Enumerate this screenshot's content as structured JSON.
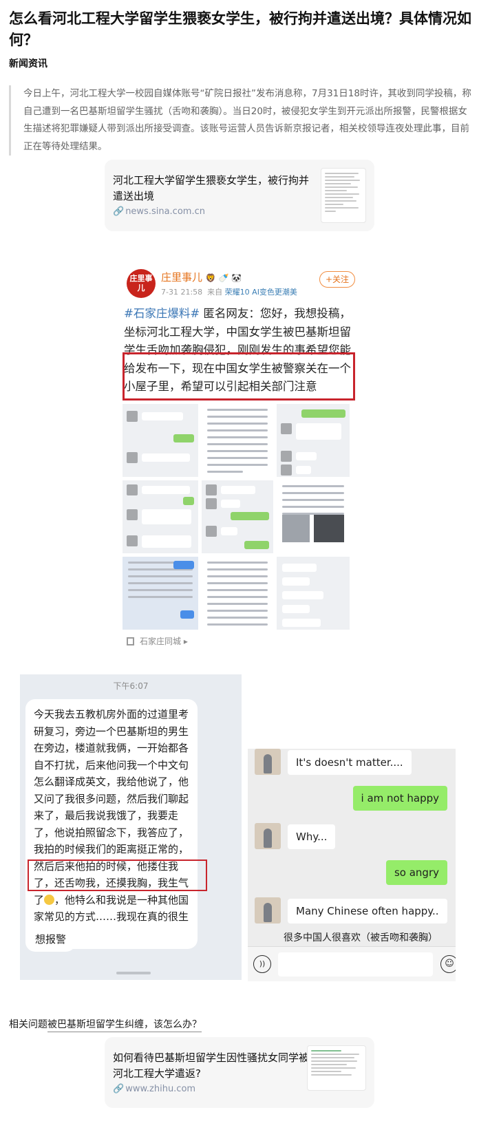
{
  "article": {
    "title": "怎么看河北工程大学留学生猥亵女学生，被行拘并遣送出境？具体情况如何？",
    "author": "新闻资讯",
    "quote": "今日上午，河北工程大学一校园自媒体账号“矿院日报社”发布消息称，7月31日18时许，其收到同学投稿，称自己遭到一名巴基斯坦留学生骚扰（舌吻和袭胸）。当日20时，被侵犯女学生到开元派出所报警，民警根据女生描述将犯罪嫌疑人带到派出所接受调查。该账号运营人员告诉新京报记者，相关校领导连夜处理此事，目前正在等待处理结果。"
  },
  "link_card_1": {
    "title": "河北工程大学留学生猥亵女学生，被行拘并遣送出境",
    "url": "news.sina.com.cn",
    "icon": "link-chain-icon"
  },
  "weibo": {
    "avatar_text": "庄里事儿",
    "name": "庄里事儿",
    "badges": "🦁 🍼 🐼",
    "time": "7-31 21:58",
    "source_prefix": "来自",
    "device": "荣耀10 AI变色更潮美",
    "follow_label": "+关注",
    "hashtag": "#石家庄爆料#",
    "text_1": "匿名网友：您好，我想投稿，坐标河北工程大学，中国女学生被巴基斯坦留学生舌吻加袭胸侵犯，刚刚发生的事",
    "text_2": "希望您能给发布一下，现在中国女学生被警察关在一个小屋子里，希望可以引起相关部门注意",
    "location": "石家庄同城",
    "location_icon": "location-grid-icon"
  },
  "chat_left": {
    "time": "下午6:07",
    "message_1": "今天我去五教机房外面的过道里考研复习，旁边一个巴基斯坦的男生在旁边，楼道就我俩，一开始都各自不打扰，后来他问我一个中文句怎么翻译成英文，我给他说了，他又问了我很多问题，然后我们聊起来了，最后我说我饿了，我要走了，他说拍照留念下，我答应了，我拍的时候我们的距离挺正常的，然后后来他拍的时候，他搂住我了，还舌吻我，还摸我胸，我生气了",
    "message_1_tail": "，他特么和我说是一种其他国家常见的方式……我现在真的很生气",
    "message_2": "想报警"
  },
  "chat_right": {
    "messages": [
      {
        "side": "in",
        "text": "It's doesn't matter...."
      },
      {
        "side": "out",
        "text": "i am not happy"
      },
      {
        "side": "in",
        "text": "Why..."
      },
      {
        "side": "out",
        "text": "so angry"
      },
      {
        "side": "in",
        "text": "Many Chinese often happy.."
      }
    ],
    "caption": "很多中国人很喜欢（被舌吻和袭胸）",
    "voice_icon": "voice-icon",
    "emoji_icon": "emoji-icon"
  },
  "related": {
    "prefix": "相关问题",
    "link": "被巴基斯坦留学生纠缠，该怎么办？"
  },
  "link_card_2": {
    "title": "如何看待巴基斯坦留学生因性骚扰女同学被河北工程大学遣返?",
    "url": "www.zhihu.com",
    "icon": "link-chain-icon"
  },
  "colors": {
    "highlight_red": "#c8242c",
    "weibo_orange": "#e5731c",
    "weibo_blue": "#3a76b5",
    "wechat_green": "#95ec69",
    "link_gray": "#8590a6"
  }
}
